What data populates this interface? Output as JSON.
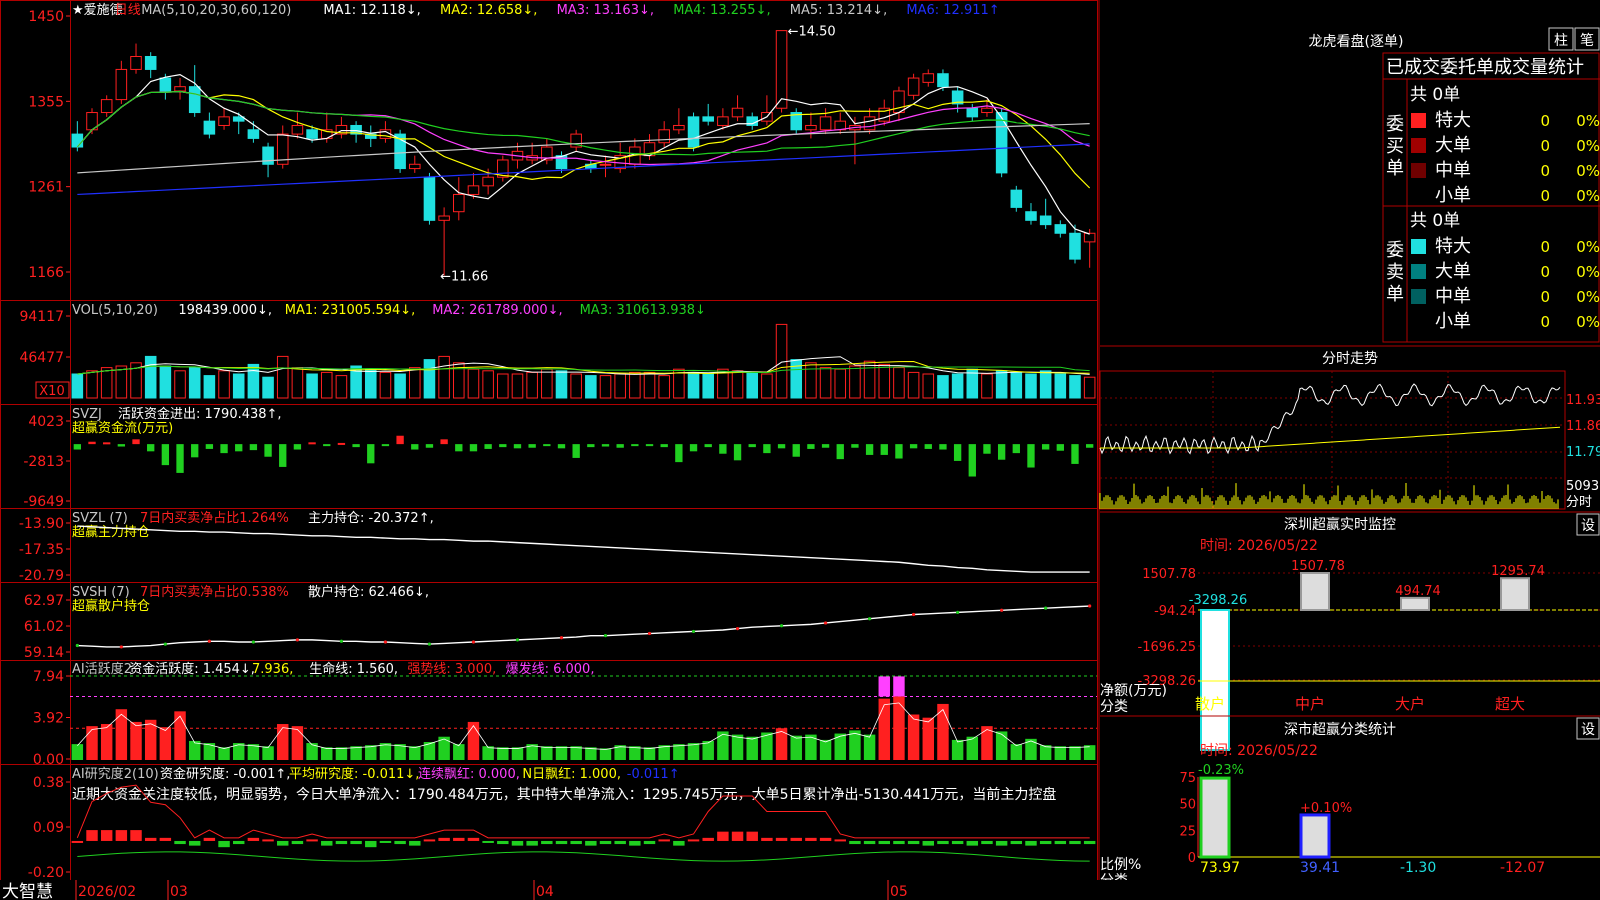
{
  "app": {
    "brand": "大智慧",
    "stock": "★爱施德",
    "period": "日线"
  },
  "colors": {
    "up": "#ff2020",
    "down": "#20e0e0",
    "ma1": "#ffffff",
    "ma2": "#ffff00",
    "ma3": "#ff40ff",
    "ma4": "#20d020",
    "ma5": "#c8c8c8",
    "ma6": "#2030ff",
    "panel_border": "#b00000",
    "grid": "#800000"
  },
  "main": {
    "ma_header": {
      "label": "MA(5,10,20,30,60,120)",
      "ma1": "MA1: 12.118↓,",
      "ma2": "MA2: 12.658↓,",
      "ma3": "MA3: 13.163↓,",
      "ma4": "MA4: 13.255↓,",
      "ma5": "MA5: 13.214↓,",
      "ma6": "MA6: 12.911↑"
    },
    "y_ticks": [
      "1450",
      "1355",
      "1261",
      "1166"
    ],
    "high_label": "14.50",
    "low_label": "11.66"
  },
  "vol": {
    "header": {
      "label": "VOL(5,10,20)",
      "value": "198439.000↓,",
      "ma1": "MA1: 231005.594↓,",
      "ma2": "MA2: 261789.000↓,",
      "ma3": "MA3: 310613.938↓"
    },
    "y_ticks": [
      "94117",
      "46477",
      "X10"
    ]
  },
  "svzj": {
    "header": {
      "label": "SVZJ",
      "desc": "活跃资金进出: 1790.438↑,",
      "sub": "超赢资金流(万元)"
    },
    "y_ticks": [
      "4023",
      "-2813",
      "-9649"
    ]
  },
  "svzl": {
    "header": {
      "label": "SVZL (7)",
      "desc": "7日内买卖净占比1.264%",
      "val": "主力持仓: -20.372↑,",
      "sub": "超赢主力持仓"
    },
    "y_ticks": [
      "-13.90",
      "-17.35",
      "-20.79"
    ]
  },
  "svsh": {
    "header": {
      "label": "SVSH (7)",
      "desc": "7日内买卖净占比0.538%",
      "val": "散户持仓: 62.466↓,",
      "sub": "超赢散户持仓"
    },
    "y_ticks": [
      "62.97",
      "61.02",
      "59.14"
    ]
  },
  "ai1": {
    "header": {
      "label": "AI活跃度2",
      "desc": "资金活跃度: 1.454↓,",
      "v2": "7.936,",
      "life": "生命线: 1.560,",
      "strong": "强势线: 3.000,",
      "burst": "爆发线: 6.000,"
    },
    "y_ticks": [
      "7.94",
      "3.92",
      "0.00"
    ]
  },
  "ai2": {
    "header": {
      "label": "AI研究度2(10)",
      "desc": "资金研究度: -0.001↑,",
      "avg": "平均研究度: -0.011↓,",
      "red": "连续飘红: 0.000,",
      "nred": "N日飘红: 1.000,",
      "last": "-0.011↑"
    },
    "comment": "近期大资金关注度较低，明显弱势，今日大单净流入：1790.484万元，其中特大单净流入：1295.745万元，大单5日累计净出-5130.441万元，当前主力控盘",
    "y_ticks": [
      "0.38",
      "0.09",
      "-0.20"
    ]
  },
  "xaxis": {
    "labels": [
      "2026/02",
      "03",
      "04",
      "05"
    ]
  },
  "right": {
    "lhb": {
      "title": "龙虎看盘(逐单)",
      "btn_zhu": "柱",
      "btn_bi": "笔",
      "tabs": [
        "已成交",
        "委托单",
        "成交量统计"
      ],
      "buy": {
        "side_label": "委买单",
        "total": "共 0单",
        "rows": [
          {
            "name": "特大",
            "count": "0",
            "pct": "0%"
          },
          {
            "name": "大单",
            "count": "0",
            "pct": "0%"
          },
          {
            "name": "中单",
            "count": "0",
            "pct": "0%"
          },
          {
            "name": "小单",
            "count": "0",
            "pct": "0%"
          }
        ]
      },
      "sell": {
        "side_label": "委卖单",
        "total": "共 0单",
        "rows": [
          {
            "name": "特大",
            "count": "0",
            "pct": "0%"
          },
          {
            "name": "大单",
            "count": "0",
            "pct": "0%"
          },
          {
            "name": "中单",
            "count": "0",
            "pct": "0%"
          },
          {
            "name": "小单",
            "count": "0",
            "pct": "0%"
          }
        ]
      }
    },
    "fenshi": {
      "title": "分时走势",
      "y_ticks": [
        "11.93",
        "11.86",
        "11.79"
      ],
      "vol_tick": "5093",
      "vol_unit": "分时"
    },
    "monitor": {
      "title": "深圳超赢实时监控",
      "set": "设",
      "time": "时间: 2026/05/22",
      "y_ticks": [
        "1507.78",
        "-94.24",
        "-1696.25",
        "-3298.26"
      ],
      "ylabel": "净额(万元)",
      "xlabel": "分类",
      "categories": [
        "散户",
        "中户",
        "大户",
        "超大"
      ],
      "values": [
        -3298.26,
        1507.78,
        494.74,
        1295.74
      ],
      "value_labels": [
        "-3298.26",
        "1507.78",
        "494.74",
        "1295.74"
      ]
    },
    "stats": {
      "title": "深市超赢分类统计",
      "set": "设",
      "time": "时间: 2026/05/22",
      "y_ticks": [
        "75",
        "50",
        "25",
        "0"
      ],
      "ylabel": "比例%",
      "xlabel": "分类",
      "categories": [
        "散户",
        "中户",
        "大户",
        "超大"
      ],
      "values": [
        73.97,
        39.41,
        -1.3,
        -12.07
      ],
      "value_labels": [
        "73.97",
        "39.41",
        "-1.30",
        "-12.07"
      ],
      "changes": [
        "-0.23%",
        "+0.10%"
      ]
    }
  },
  "chart_data": [
    {
      "type": "candlestick",
      "title": "爱施德 日线",
      "ylim": [
        11.66,
        14.5
      ],
      "note": "daily OHLC, Feb-May 2026 (approximate, read from chart)",
      "candles": [
        [
          13.3,
          13.15,
          13.45,
          13.1
        ],
        [
          13.35,
          13.55,
          13.6,
          13.3
        ],
        [
          13.55,
          13.7,
          13.75,
          13.5
        ],
        [
          13.7,
          14.05,
          14.15,
          13.65
        ],
        [
          14.05,
          14.2,
          14.35,
          14.0
        ],
        [
          14.2,
          14.05,
          14.25,
          13.95
        ],
        [
          13.95,
          13.8,
          14.0,
          13.7
        ],
        [
          13.8,
          13.85,
          13.95,
          13.7
        ],
        [
          13.85,
          13.55,
          14.1,
          13.5
        ],
        [
          13.45,
          13.3,
          13.55,
          13.25
        ],
        [
          13.4,
          13.5,
          13.6,
          13.35
        ],
        [
          13.5,
          13.45,
          13.55,
          13.3
        ],
        [
          13.35,
          13.25,
          13.45,
          13.2
        ],
        [
          13.15,
          12.95,
          13.2,
          12.8
        ],
        [
          12.95,
          13.3,
          13.4,
          12.9
        ],
        [
          13.3,
          13.4,
          13.55,
          13.25
        ],
        [
          13.35,
          13.25,
          13.4,
          13.2
        ],
        [
          13.25,
          13.35,
          13.55,
          13.2
        ],
        [
          13.3,
          13.4,
          13.5,
          13.25
        ],
        [
          13.4,
          13.3,
          13.45,
          13.2
        ],
        [
          13.3,
          13.25,
          13.4,
          13.15
        ],
        [
          13.25,
          13.35,
          13.45,
          13.2
        ],
        [
          13.3,
          12.9,
          13.35,
          12.85
        ],
        [
          12.9,
          12.95,
          13.05,
          12.85
        ],
        [
          12.8,
          12.3,
          12.85,
          12.25
        ],
        [
          12.3,
          12.35,
          12.45,
          11.66
        ],
        [
          12.4,
          12.6,
          12.8,
          12.3
        ],
        [
          12.6,
          12.7,
          12.85,
          12.55
        ],
        [
          12.7,
          12.8,
          12.9,
          12.6
        ],
        [
          12.8,
          13.0,
          13.05,
          12.75
        ],
        [
          13.0,
          13.1,
          13.2,
          12.9
        ],
        [
          13.0,
          13.05,
          13.2,
          12.95
        ],
        [
          13.0,
          13.15,
          13.25,
          12.95
        ],
        [
          13.05,
          12.9,
          13.1,
          12.85
        ],
        [
          13.15,
          13.3,
          13.35,
          13.1
        ],
        [
          12.95,
          12.9,
          13.0,
          12.85
        ],
        [
          12.95,
          12.95,
          13.05,
          12.8
        ],
        [
          12.9,
          13.05,
          13.2,
          12.85
        ],
        [
          12.95,
          13.15,
          13.25,
          12.9
        ],
        [
          13.05,
          13.2,
          13.3,
          13.0
        ],
        [
          13.2,
          13.35,
          13.45,
          13.15
        ],
        [
          13.35,
          13.4,
          13.6,
          13.3
        ],
        [
          13.5,
          13.15,
          13.55,
          13.1
        ],
        [
          13.5,
          13.45,
          13.65,
          13.4
        ],
        [
          13.4,
          13.5,
          13.6,
          13.35
        ],
        [
          13.5,
          13.6,
          13.75,
          13.45
        ],
        [
          13.5,
          13.4,
          13.55,
          13.35
        ],
        [
          13.45,
          13.55,
          13.75,
          13.4
        ],
        [
          13.6,
          14.5,
          14.5,
          13.55
        ],
        [
          13.55,
          13.35,
          13.6,
          13.3
        ],
        [
          13.35,
          13.4,
          13.55,
          13.25
        ],
        [
          13.35,
          13.5,
          13.6,
          13.3
        ],
        [
          13.35,
          13.45,
          13.55,
          13.3
        ],
        [
          13.35,
          13.4,
          13.5,
          12.95
        ],
        [
          13.35,
          13.5,
          13.6,
          13.3
        ],
        [
          13.45,
          13.6,
          13.7,
          13.4
        ],
        [
          13.55,
          13.8,
          13.85,
          13.45
        ],
        [
          13.75,
          13.95,
          14.0,
          13.7
        ],
        [
          13.9,
          14.0,
          14.05,
          13.85
        ],
        [
          14.0,
          13.85,
          14.05,
          13.8
        ],
        [
          13.8,
          13.65,
          13.85,
          13.55
        ],
        [
          13.6,
          13.5,
          13.65,
          13.45
        ],
        [
          13.55,
          13.6,
          13.7,
          13.5
        ],
        [
          13.55,
          12.85,
          13.6,
          12.8
        ],
        [
          12.65,
          12.45,
          12.7,
          12.4
        ],
        [
          12.4,
          12.3,
          12.5,
          12.25
        ],
        [
          12.35,
          12.25,
          12.55,
          12.2
        ],
        [
          12.25,
          12.15,
          12.3,
          12.1
        ],
        [
          12.15,
          11.85,
          12.25,
          11.8
        ],
        [
          12.05,
          12.15,
          12.2,
          11.75
        ]
      ]
    },
    {
      "type": "bar",
      "title": "VOL(5,10,20)",
      "ylim": [
        0,
        94117
      ],
      "values": [
        30,
        34,
        38,
        40,
        44,
        52,
        40,
        34,
        38,
        28,
        34,
        30,
        42,
        26,
        52,
        38,
        30,
        32,
        28,
        40,
        36,
        32,
        30,
        38,
        48,
        52,
        44,
        36,
        34,
        30,
        30,
        32,
        36,
        34,
        30,
        28,
        28,
        30,
        32,
        32,
        28,
        36,
        32,
        30,
        36,
        34,
        32,
        30,
        92,
        48,
        44,
        38,
        36,
        40,
        46,
        42,
        38,
        32,
        30,
        28,
        30,
        36,
        30,
        34,
        32,
        30,
        34,
        30,
        28,
        26
      ]
    },
    {
      "type": "bar",
      "title": "超赢资金流(万元)",
      "ylim": [
        -9649,
        4023
      ],
      "values": [
        -900,
        400,
        300,
        -400,
        800,
        -1200,
        -3500,
        -4800,
        -2200,
        -800,
        -1500,
        -1200,
        -1000,
        -2100,
        -3800,
        -900,
        300,
        -200,
        200,
        -500,
        -3200,
        -200,
        1400,
        -900,
        -600,
        800,
        -1200,
        -1200,
        -800,
        -500,
        -700,
        -600,
        -300,
        -700,
        -2300,
        -500,
        -400,
        -600,
        -300,
        -300,
        -500,
        -3000,
        -1200,
        -500,
        -1600,
        -2700,
        -500,
        -1500,
        -700,
        -2100,
        -800,
        -600,
        -2500,
        -600,
        -1800,
        -1800,
        -2400,
        -700,
        -800,
        -900,
        -2800,
        -5400,
        -1600,
        -2600,
        -1500,
        -3900,
        -900,
        -1100,
        -3300,
        -600
      ]
    },
    {
      "type": "line",
      "title": "超赢主力持仓",
      "ylim": [
        -20.79,
        -13.9
      ],
      "values": [
        -14.3,
        -14.4,
        -14.5,
        -14.6,
        -14.7,
        -14.8,
        -14.9,
        -15.0,
        -15.0,
        -15.1,
        -15.1,
        -15.2,
        -15.3,
        -15.3,
        -15.4,
        -15.5,
        -15.6,
        -15.6,
        -15.7,
        -15.8,
        -15.8,
        -15.9,
        -16.0,
        -16.0,
        -16.1,
        -16.1,
        -16.2,
        -16.3,
        -16.3,
        -16.4,
        -16.5,
        -16.6,
        -16.7,
        -16.8,
        -16.9,
        -17.0,
        -17.1,
        -17.2,
        -17.3,
        -17.4,
        -17.5,
        -17.6,
        -17.7,
        -17.8,
        -17.9,
        -18.0,
        -18.1,
        -18.2,
        -18.3,
        -18.4,
        -18.5,
        -18.6,
        -18.7,
        -18.8,
        -18.9,
        -19.0,
        -19.1,
        -19.3,
        -19.5,
        -19.6,
        -19.8,
        -19.9,
        -20.1,
        -20.2,
        -20.3,
        -20.4,
        -20.4,
        -20.4,
        -20.4,
        -20.4
      ]
    },
    {
      "type": "line",
      "title": "超赢散户持仓",
      "ylim": [
        59.14,
        62.97
      ],
      "values": [
        59.6,
        59.55,
        59.5,
        59.5,
        59.55,
        59.6,
        59.7,
        59.8,
        59.85,
        59.9,
        59.9,
        59.85,
        59.85,
        59.9,
        59.95,
        60.0,
        60.0,
        59.95,
        59.9,
        59.9,
        59.85,
        59.85,
        59.8,
        59.75,
        59.7,
        59.75,
        59.8,
        59.85,
        59.9,
        59.95,
        60.0,
        60.05,
        60.1,
        60.15,
        60.2,
        60.3,
        60.3,
        60.35,
        60.4,
        60.45,
        60.5,
        60.55,
        60.6,
        60.65,
        60.7,
        60.8,
        60.9,
        60.95,
        61.0,
        61.05,
        61.1,
        61.2,
        61.3,
        61.4,
        61.5,
        61.6,
        61.7,
        61.8,
        61.85,
        61.9,
        61.95,
        62.0,
        62.05,
        62.1,
        62.15,
        62.2,
        62.25,
        62.3,
        62.35,
        62.4
      ]
    },
    {
      "type": "bar",
      "title": "AI活跃度2",
      "ylim": [
        0,
        7.94
      ],
      "values": [
        1.5,
        3.2,
        3.4,
        4.8,
        3.6,
        3.8,
        3.1,
        4.6,
        1.8,
        1.6,
        1.2,
        1.6,
        1.5,
        1.3,
        3.4,
        3.2,
        1.6,
        1.2,
        1.2,
        1.3,
        1.4,
        1.6,
        1.5,
        1.3,
        1.7,
        2.2,
        1.5,
        3.6,
        1.3,
        1.2,
        1.2,
        1.5,
        1.3,
        1.3,
        1.3,
        1.2,
        1.1,
        1.4,
        1.3,
        1.2,
        1.4,
        1.5,
        1.6,
        1.8,
        2.7,
        2.4,
        2.2,
        2.6,
        3.0,
        2.3,
        2.4,
        1.9,
        2.5,
        2.8,
        2.4,
        5.8,
        6.0,
        4.3,
        4.0,
        5.3,
        1.9,
        2.2,
        3.2,
        2.7,
        1.5,
        2.0,
        1.4,
        1.3,
        1.3,
        1.4
      ],
      "lines": {
        "strong": 3.0,
        "burst": 6.0
      }
    },
    {
      "type": "bar",
      "title": "AI研究度2(10)",
      "ylim": [
        -0.2,
        0.38
      ],
      "values": [
        0.0,
        0.07,
        0.07,
        0.07,
        0.07,
        0.02,
        0.02,
        -0.02,
        -0.03,
        0.02,
        -0.04,
        -0.02,
        0.02,
        0.01,
        -0.03,
        -0.02,
        0.01,
        -0.03,
        -0.02,
        -0.02,
        -0.04,
        -0.01,
        -0.02,
        -0.03,
        0.01,
        0.02,
        0.02,
        0.02,
        -0.01,
        -0.02,
        -0.03,
        -0.03,
        -0.02,
        -0.02,
        -0.02,
        -0.03,
        -0.02,
        -0.02,
        -0.03,
        -0.02,
        0.01,
        -0.03,
        0.01,
        0.02,
        0.06,
        0.06,
        0.06,
        0.02,
        0.02,
        0.02,
        0.02,
        0.02,
        0.01,
        -0.02,
        -0.02,
        -0.02,
        -0.02,
        -0.02,
        -0.03,
        -0.02,
        -0.02,
        -0.03,
        -0.02,
        -0.03,
        -0.02,
        -0.03,
        -0.02,
        -0.02,
        -0.02,
        -0.02
      ]
    }
  ]
}
